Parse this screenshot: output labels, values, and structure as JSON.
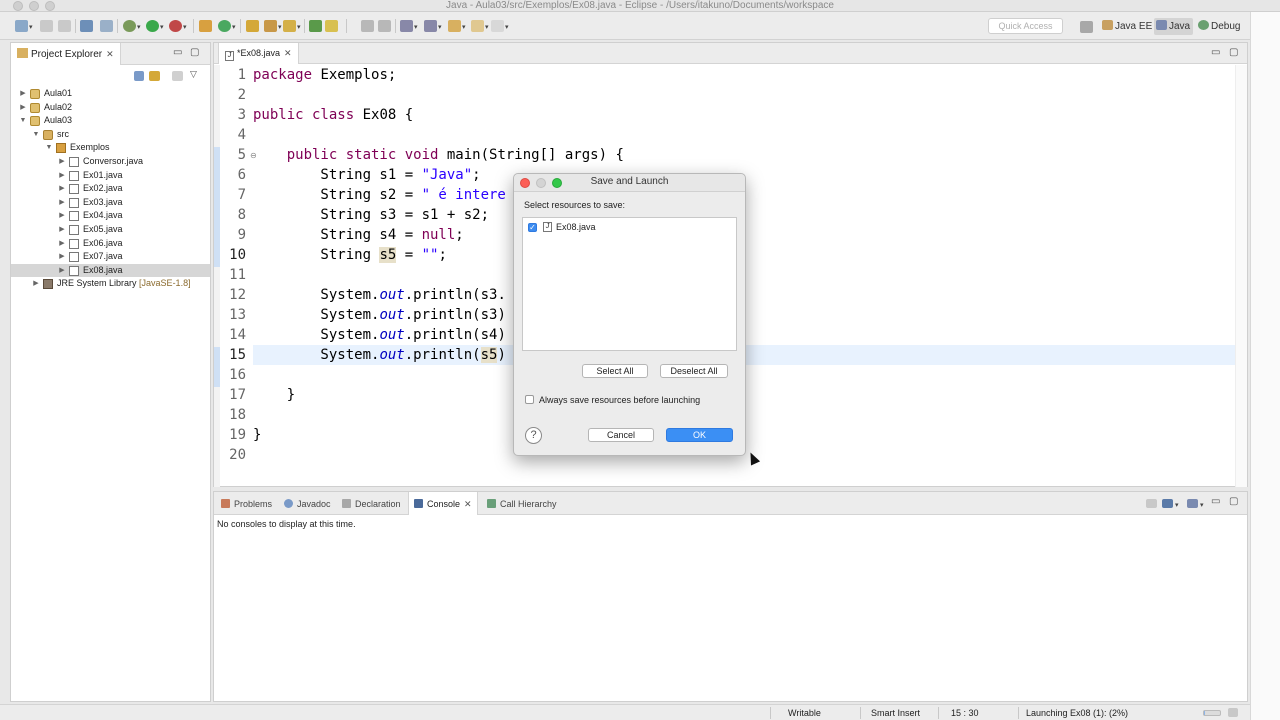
{
  "window": {
    "title": "Java - Aula03/src/Exemplos/Ex08.java - Eclipse - /Users/itakuno/Documents/workspace"
  },
  "toolbar": {
    "quick_access_placeholder": "Quick Access",
    "perspectives": [
      {
        "label": "Java EE",
        "icon": "java-ee-perspective-icon",
        "active": false
      },
      {
        "label": "Java",
        "icon": "java-perspective-icon",
        "active": true
      },
      {
        "label": "Debug",
        "icon": "debug-perspective-icon",
        "active": false
      }
    ]
  },
  "explorer": {
    "tab_label": "Project Explorer",
    "tree": [
      {
        "label": "Aula01",
        "level": 0,
        "expanded": false,
        "icon": "project-icon"
      },
      {
        "label": "Aula02",
        "level": 0,
        "expanded": false,
        "icon": "project-icon"
      },
      {
        "label": "Aula03",
        "level": 0,
        "expanded": true,
        "icon": "project-icon"
      },
      {
        "label": "src",
        "level": 1,
        "expanded": true,
        "icon": "source-folder-icon"
      },
      {
        "label": "Exemplos",
        "level": 2,
        "expanded": true,
        "icon": "package-icon"
      },
      {
        "label": "Conversor.java",
        "level": 3,
        "expanded": false,
        "icon": "java-file-icon"
      },
      {
        "label": "Ex01.java",
        "level": 3,
        "expanded": false,
        "icon": "java-file-icon"
      },
      {
        "label": "Ex02.java",
        "level": 3,
        "expanded": false,
        "icon": "java-file-icon"
      },
      {
        "label": "Ex03.java",
        "level": 3,
        "expanded": false,
        "icon": "java-file-icon"
      },
      {
        "label": "Ex04.java",
        "level": 3,
        "expanded": false,
        "icon": "java-file-icon"
      },
      {
        "label": "Ex05.java",
        "level": 3,
        "expanded": false,
        "icon": "java-file-icon"
      },
      {
        "label": "Ex06.java",
        "level": 3,
        "expanded": false,
        "icon": "java-file-icon"
      },
      {
        "label": "Ex07.java",
        "level": 3,
        "expanded": false,
        "icon": "java-file-icon"
      },
      {
        "label": "Ex08.java",
        "level": 3,
        "expanded": false,
        "icon": "java-file-icon",
        "selected": true
      },
      {
        "label": "JRE System Library",
        "hint": "[JavaSE-1.8]",
        "level": 1,
        "expanded": false,
        "icon": "library-icon"
      }
    ]
  },
  "editor": {
    "tab_label": "*Ex08.java",
    "current_line": 15,
    "lines": [
      {
        "n": "1",
        "html": "<span class=\"kw\">package</span> Exemplos;"
      },
      {
        "n": "2",
        "html": ""
      },
      {
        "n": "3",
        "html": "<span class=\"kw\">public class</span> Ex08 {"
      },
      {
        "n": "4",
        "html": ""
      },
      {
        "n": "5",
        "html": "    <span class=\"kw\">public static void</span> main(String[] args) {"
      },
      {
        "n": "6",
        "html": "        String s1 = <span class=\"str\">\"Java\"</span>;"
      },
      {
        "n": "7",
        "html": "        String s2 = <span class=\"str\">\" é intere</span>"
      },
      {
        "n": "8",
        "html": "        String s3 = s1 + s2;"
      },
      {
        "n": "9",
        "html": "        String s4 = <span class=\"kw\">null</span>;"
      },
      {
        "n": "10",
        "html": "        String <span class=\"hl\">s5</span> = <span class=\"str\">\"\"</span>;"
      },
      {
        "n": "11",
        "html": ""
      },
      {
        "n": "12",
        "html": "        System.<span class=\"fld\">out</span>.println(s3."
      },
      {
        "n": "13",
        "html": "        System.<span class=\"fld\">out</span>.println(s3)"
      },
      {
        "n": "14",
        "html": "        System.<span class=\"fld\">out</span>.println(s4)"
      },
      {
        "n": "15",
        "html": "        System.<span class=\"fld\">out</span>.println(<span class=\"hl\">s5</span>)"
      },
      {
        "n": "16",
        "html": ""
      },
      {
        "n": "17",
        "html": "    }"
      },
      {
        "n": "18",
        "html": ""
      },
      {
        "n": "19",
        "html": "}"
      },
      {
        "n": "20",
        "html": ""
      }
    ]
  },
  "bottom_panel": {
    "tabs": [
      {
        "label": "Problems",
        "icon": "problems-icon",
        "active": false
      },
      {
        "label": "Javadoc",
        "icon": "javadoc-icon",
        "active": false
      },
      {
        "label": "Declaration",
        "icon": "declaration-icon",
        "active": false
      },
      {
        "label": "Console",
        "icon": "console-icon",
        "active": true
      },
      {
        "label": "Call Hierarchy",
        "icon": "call-hierarchy-icon",
        "active": false
      }
    ],
    "console_message": "No consoles to display at this time."
  },
  "statusbar": {
    "writable": "Writable",
    "insert_mode": "Smart Insert",
    "position": "15 : 30",
    "task": "Launching Ex08 (1): (2%)",
    "progress": 0.02
  },
  "dialog": {
    "title": "Save and Launch",
    "caption": "Select resources to save:",
    "resources": [
      {
        "label": "Ex08.java",
        "checked": true
      }
    ],
    "select_all_label": "Select All",
    "deselect_all_label": "Deselect All",
    "always_save_label": "Always save resources before launching",
    "always_save_checked": false,
    "cancel_label": "Cancel",
    "ok_label": "OK",
    "help_glyph": "?"
  },
  "colors": {
    "accent": "#3b8ff4",
    "keyword": "#7f0055",
    "string": "#2a00ff",
    "field": "#0000c0"
  }
}
